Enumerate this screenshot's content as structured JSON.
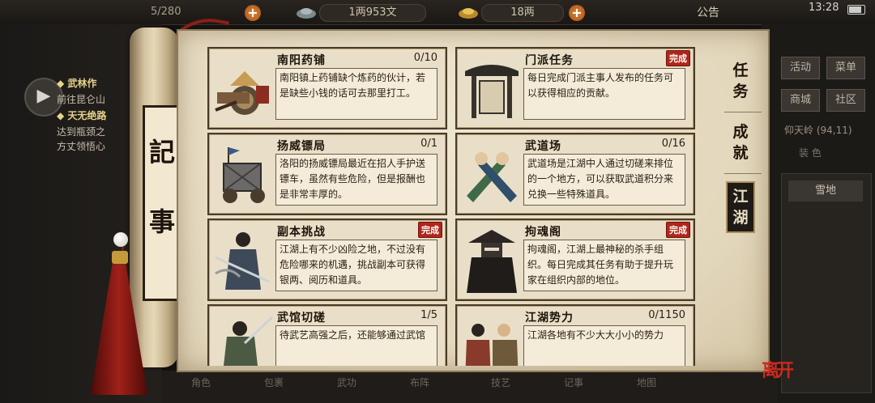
{
  "top": {
    "inventory": "5/280",
    "copper": "1两953文",
    "silver": "18两",
    "announcement": "公告",
    "time": "13:28"
  },
  "left_quests": [
    {
      "text": "◆ 武林作",
      "gold": true
    },
    {
      "text": "前往昆仑山",
      "gold": false
    },
    {
      "text": "◆ 天无绝路",
      "gold": true
    },
    {
      "text": "达到瓶颈之",
      "gold": false
    },
    {
      "text": "方丈领悟心",
      "gold": false
    }
  ],
  "right_menu": [
    "活动",
    "菜单",
    "商城",
    "社区"
  ],
  "location": "仰天岭 (94,11)",
  "right_small": "装 色",
  "snow_item": "雪地",
  "bottom_nav": [
    "角色",
    "包裹",
    "武功",
    "布阵",
    "技艺",
    "记事",
    "地图"
  ],
  "scroll_label": [
    "記",
    "事"
  ],
  "tabs": [
    {
      "label": "任务",
      "active": false
    },
    {
      "label": "成就",
      "active": false
    },
    {
      "label": "江湖",
      "active": true
    }
  ],
  "cards": [
    {
      "title": "南阳药铺",
      "count": "0/10",
      "done": "",
      "icon": "medicine-cart-icon",
      "desc": "南阳镇上药铺缺个炼药的伙计，若是缺些小钱的话可去那里打工。"
    },
    {
      "title": "门派任务",
      "count": "",
      "done": "完成",
      "icon": "sect-gate-icon",
      "desc": "每日完成门派主事人发布的任务可以获得相应的贡献。"
    },
    {
      "title": "扬威镖局",
      "count": "0/1",
      "done": "",
      "icon": "escort-cart-icon",
      "desc": "洛阳的扬威镖局最近在招人手护送镖车，虽然有些危险，但是报酬也是非常丰厚的。"
    },
    {
      "title": "武道场",
      "count": "0/16",
      "done": "",
      "icon": "crossed-fists-icon",
      "desc": "武道场是江湖中人通过切磋来排位的一个地方，可以获取武道积分来兑换一些特殊道具。"
    },
    {
      "title": "副本挑战",
      "count": "",
      "done": "完成",
      "icon": "swordsman-icon",
      "desc": "江湖上有不少凶险之地，不过没有危险哪来的机遇，挑战副本可获得银两、阅历和道具。"
    },
    {
      "title": "拘魂阁",
      "count": "",
      "done": "完成",
      "icon": "assassin-icon",
      "desc": "拘魂阁，江湖上最神秘的杀手组织。每日完成其任务有助于提升玩家在组织内部的地位。"
    },
    {
      "title": "武馆切磋",
      "count": "1/5",
      "done": "",
      "icon": "martial-hall-icon",
      "desc": "待武艺高强之后，还能够通过武馆"
    },
    {
      "title": "江湖势力",
      "count": "0/1150",
      "done": "",
      "icon": "faction-icon",
      "desc": "江湖各地有不少大大小小的势力"
    }
  ]
}
